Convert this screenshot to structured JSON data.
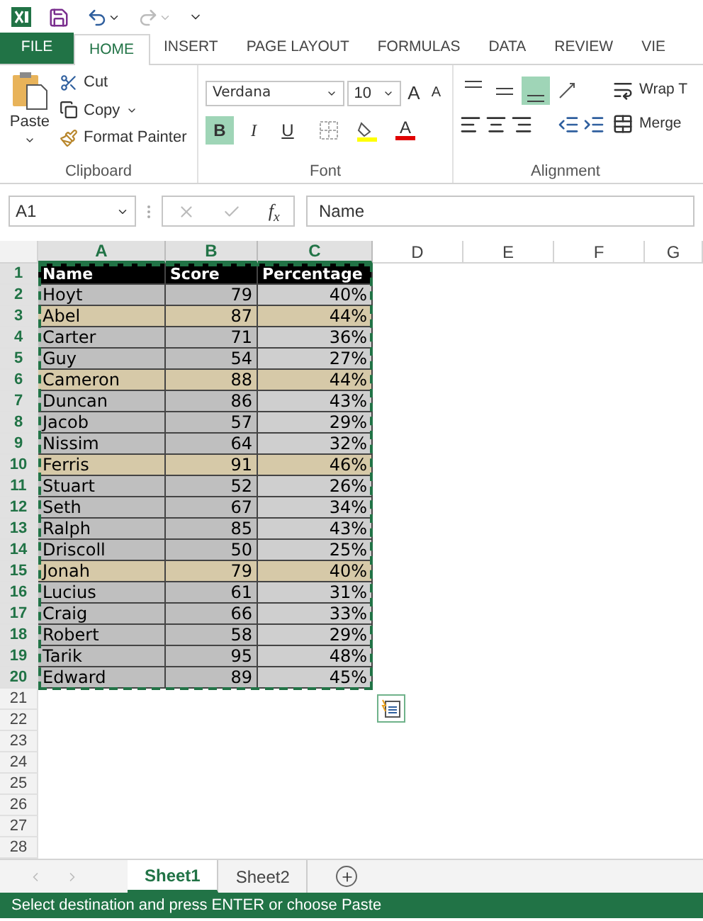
{
  "tabs": [
    {
      "label": "FILE",
      "kind": "file",
      "selected": false
    },
    {
      "label": "HOME",
      "kind": "tab",
      "selected": true
    },
    {
      "label": "INSERT",
      "kind": "tab",
      "selected": false
    },
    {
      "label": "PAGE LAYOUT",
      "kind": "tab",
      "selected": false
    },
    {
      "label": "FORMULAS",
      "kind": "tab",
      "selected": false
    },
    {
      "label": "DATA",
      "kind": "tab",
      "selected": false
    },
    {
      "label": "REVIEW",
      "kind": "tab",
      "selected": false
    },
    {
      "label": "VIE",
      "kind": "tab",
      "selected": false
    }
  ],
  "ribbon": {
    "clipboard": {
      "title": "Clipboard",
      "paste": "Paste",
      "cut": "Cut",
      "copy": "Copy",
      "format_painter": "Format Painter"
    },
    "font": {
      "title": "Font",
      "font_name": "Verdana",
      "font_size": "10",
      "grow": "A",
      "shrink": "A",
      "styles": [
        {
          "label": "B",
          "on": true
        },
        {
          "label": "I",
          "on": false
        },
        {
          "label": "U",
          "on": false
        }
      ],
      "font_color": "A"
    },
    "alignment": {
      "title": "Alignment",
      "vertical": [
        {
          "on": false
        },
        {
          "on": false
        },
        {
          "on": true
        }
      ],
      "wrap": "Wrap T",
      "merge": "Merge"
    }
  },
  "formula_bar": {
    "name_box": "A1",
    "fx": "f$_{x}$",
    "value": "Name"
  },
  "sheet": {
    "columns": [
      {
        "label": "A",
        "selected": true
      },
      {
        "label": "B",
        "selected": true
      },
      {
        "label": "C",
        "selected": true
      },
      {
        "label": "D",
        "selected": false
      },
      {
        "label": "E",
        "selected": false
      },
      {
        "label": "F",
        "selected": false
      },
      {
        "label": "G",
        "selected": false
      }
    ],
    "marquee": true,
    "rows": [
      {
        "number": "1",
        "selected": true,
        "kind": "header",
        "cells": [
          "Name",
          "Score",
          "Percentage"
        ]
      },
      {
        "number": "2",
        "selected": true,
        "kind": "data",
        "highlighted": false,
        "cells": [
          "Hoyt",
          "79",
          "40%"
        ]
      },
      {
        "number": "3",
        "selected": true,
        "kind": "data",
        "highlighted": true,
        "cells": [
          "Abel",
          "87",
          "44%"
        ]
      },
      {
        "number": "4",
        "selected": true,
        "kind": "data",
        "highlighted": false,
        "cells": [
          "Carter",
          "71",
          "36%"
        ]
      },
      {
        "number": "5",
        "selected": true,
        "kind": "data",
        "highlighted": false,
        "cells": [
          "Guy",
          "54",
          "27%"
        ]
      },
      {
        "number": "6",
        "selected": true,
        "kind": "data",
        "highlighted": true,
        "cells": [
          "Cameron",
          "88",
          "44%"
        ]
      },
      {
        "number": "7",
        "selected": true,
        "kind": "data",
        "highlighted": false,
        "cells": [
          "Duncan",
          "86",
          "43%"
        ]
      },
      {
        "number": "8",
        "selected": true,
        "kind": "data",
        "highlighted": false,
        "cells": [
          "Jacob",
          "57",
          "29%"
        ]
      },
      {
        "number": "9",
        "selected": true,
        "kind": "data",
        "highlighted": false,
        "cells": [
          "Nissim",
          "64",
          "32%"
        ]
      },
      {
        "number": "10",
        "selected": true,
        "kind": "data",
        "highlighted": true,
        "cells": [
          "Ferris",
          "91",
          "46%"
        ]
      },
      {
        "number": "11",
        "selected": true,
        "kind": "data",
        "highlighted": false,
        "cells": [
          "Stuart",
          "52",
          "26%"
        ]
      },
      {
        "number": "12",
        "selected": true,
        "kind": "data",
        "highlighted": false,
        "cells": [
          "Seth",
          "67",
          "34%"
        ]
      },
      {
        "number": "13",
        "selected": true,
        "kind": "data",
        "highlighted": false,
        "cells": [
          "Ralph",
          "85",
          "43%"
        ]
      },
      {
        "number": "14",
        "selected": true,
        "kind": "data",
        "highlighted": false,
        "cells": [
          "Driscoll",
          "50",
          "25%"
        ]
      },
      {
        "number": "15",
        "selected": true,
        "kind": "data",
        "highlighted": true,
        "cells": [
          "Jonah",
          "79",
          "40%"
        ]
      },
      {
        "number": "16",
        "selected": true,
        "kind": "data",
        "highlighted": false,
        "cells": [
          "Lucius",
          "61",
          "31%"
        ]
      },
      {
        "number": "17",
        "selected": true,
        "kind": "data",
        "highlighted": false,
        "cells": [
          "Craig",
          "66",
          "33%"
        ]
      },
      {
        "number": "18",
        "selected": true,
        "kind": "data",
        "highlighted": false,
        "cells": [
          "Robert",
          "58",
          "29%"
        ]
      },
      {
        "number": "19",
        "selected": true,
        "kind": "data",
        "highlighted": false,
        "cells": [
          "Tarik",
          "95",
          "48%"
        ]
      },
      {
        "number": "20",
        "selected": true,
        "kind": "data",
        "highlighted": false,
        "cells": [
          "Edward",
          "89",
          "45%"
        ]
      },
      {
        "number": "21",
        "selected": false,
        "kind": "empty",
        "cells": []
      },
      {
        "number": "22",
        "selected": false,
        "kind": "empty",
        "cells": []
      },
      {
        "number": "23",
        "selected": false,
        "kind": "empty",
        "cells": []
      },
      {
        "number": "24",
        "selected": false,
        "kind": "empty",
        "cells": []
      },
      {
        "number": "25",
        "selected": false,
        "kind": "empty",
        "cells": []
      },
      {
        "number": "26",
        "selected": false,
        "kind": "empty",
        "cells": []
      },
      {
        "number": "27",
        "selected": false,
        "kind": "empty",
        "cells": []
      },
      {
        "number": "28",
        "selected": false,
        "kind": "empty",
        "cells": []
      }
    ]
  },
  "sheet_tabs": [
    {
      "label": "Sheet1",
      "selected": true
    },
    {
      "label": "Sheet2",
      "selected": false
    }
  ],
  "status_bar": "Select destination and press ENTER or choose Paste"
}
